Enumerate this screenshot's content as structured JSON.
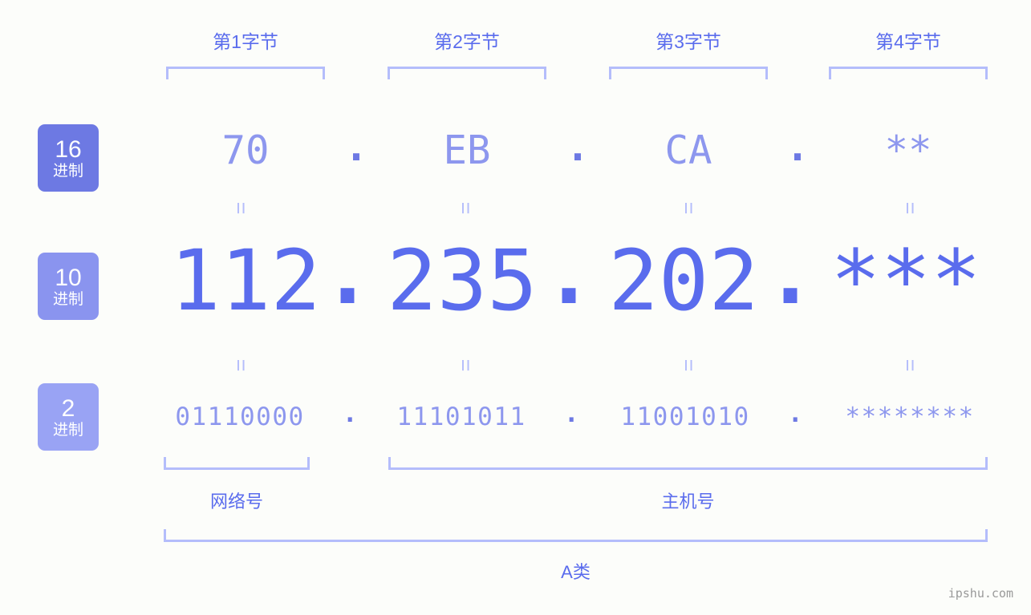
{
  "meta": {
    "watermark": "ipshu.com",
    "background_color": "#fcfdfa",
    "accent_color": "#5a6ced",
    "accent_light": "#8d97ee",
    "bracket_color": "#b4bdfb"
  },
  "byte_headers": [
    {
      "label": "第1字节"
    },
    {
      "label": "第2字节"
    },
    {
      "label": "第3字节"
    },
    {
      "label": "第4字节"
    }
  ],
  "rows": [
    {
      "key": "hex",
      "badge_num": "16",
      "badge_unit": "进制",
      "badge_color": "#6d79e3",
      "values": [
        "70",
        "EB",
        "CA",
        "**"
      ],
      "separator": "."
    },
    {
      "key": "dec",
      "badge_num": "10",
      "badge_unit": "进制",
      "badge_color": "#8a94ef",
      "values": [
        "112",
        "235",
        "202",
        "***"
      ],
      "separator": "."
    },
    {
      "key": "bin",
      "badge_num": "2",
      "badge_unit": "进制",
      "badge_color": "#99a3f4",
      "values": [
        "01110000",
        "11101011",
        "11001010",
        "********"
      ],
      "separator": "."
    }
  ],
  "equals_marks": {
    "symbol": "=",
    "count_per_row": 4
  },
  "sections": [
    {
      "key": "network",
      "label": "网络号"
    },
    {
      "key": "host",
      "label": "主机号"
    }
  ],
  "ip_class": {
    "label": "A类"
  }
}
